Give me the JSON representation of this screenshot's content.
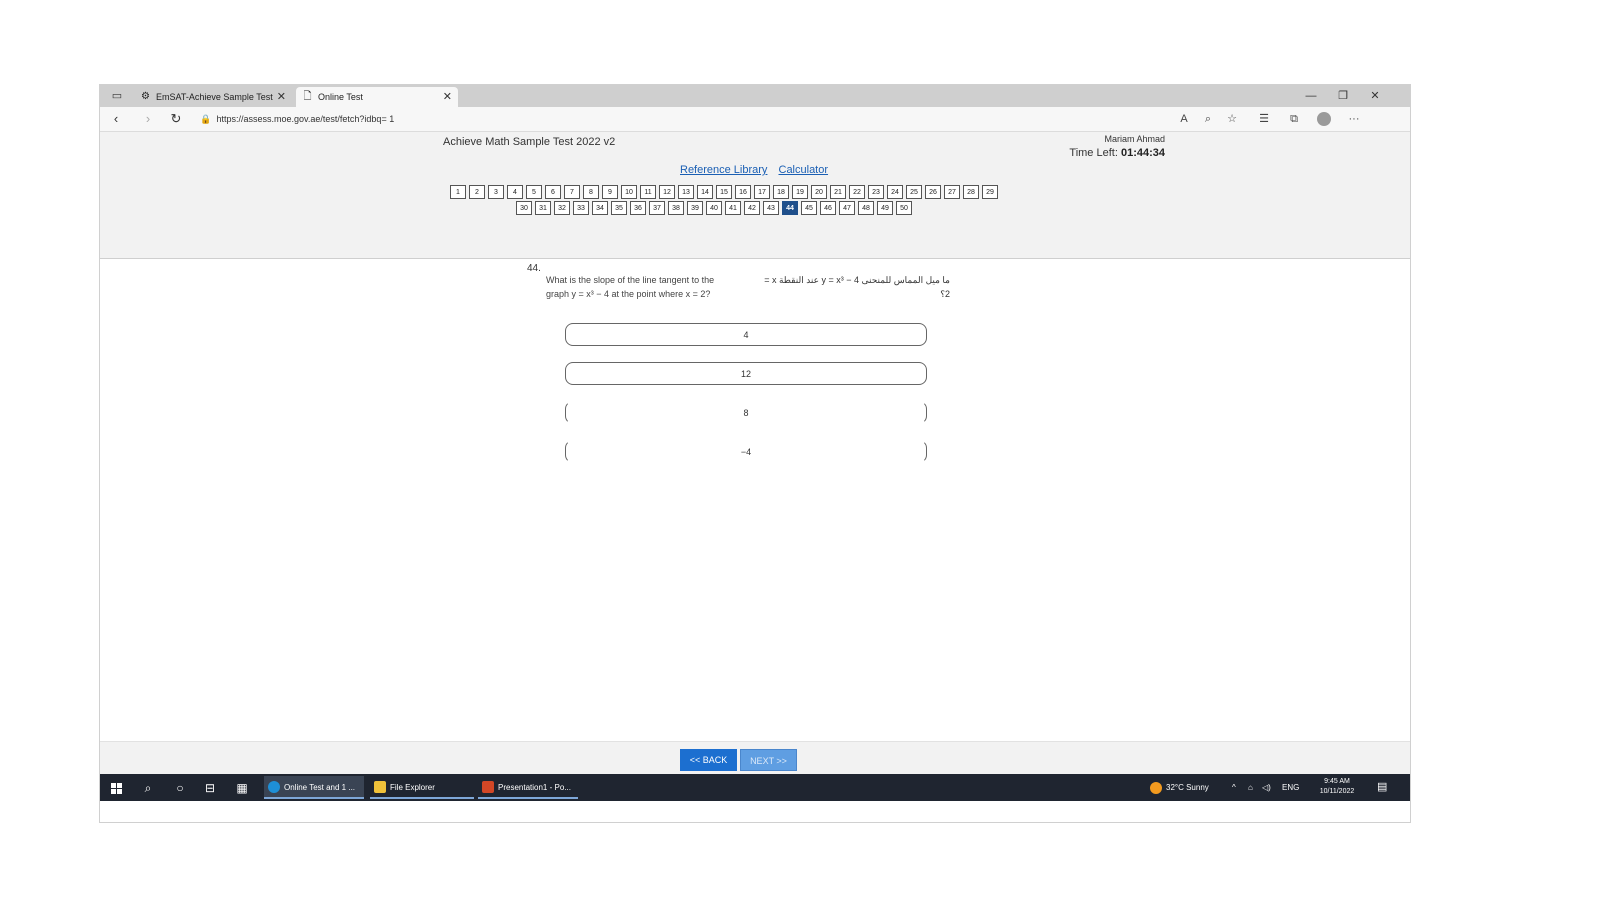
{
  "browser": {
    "tabs": [
      {
        "label": "EmSAT-Achieve Sample Test",
        "icon": "emsat-favicon"
      },
      {
        "label": "Online Test",
        "icon": "page-icon"
      }
    ],
    "url": "https://assess.moe.gov.ae/test/fetch?idbq= 1"
  },
  "test": {
    "title": "Achieve Math Sample Test 2022 v2",
    "student_name": "Mariam Ahmad",
    "time_left_label": "Time Left:",
    "time_left_value": "01:44:34",
    "links": {
      "reference": "Reference Library",
      "calculator": "Calculator"
    },
    "questions_row1": [
      "1",
      "2",
      "3",
      "4",
      "5",
      "6",
      "7",
      "8",
      "9",
      "10",
      "11",
      "12",
      "13",
      "14",
      "15",
      "16",
      "17",
      "18",
      "19",
      "20",
      "21",
      "22",
      "23",
      "24",
      "25",
      "26",
      "27",
      "28",
      "29"
    ],
    "questions_row2": [
      "30",
      "31",
      "32",
      "33",
      "34",
      "35",
      "36",
      "37",
      "38",
      "39",
      "40",
      "41",
      "42",
      "43",
      "44",
      "45",
      "46",
      "47",
      "48",
      "49",
      "50"
    ],
    "current_question": "44"
  },
  "question": {
    "number": "44.",
    "text_en_1": "What is the slope of the line tangent to the",
    "text_en_2": "graph y = x³ − 4 at the point where x = 2?",
    "text_ar_1": "ما ميل المماس للمنحنى y = x³ − 4 عند النقطة x =",
    "text_ar_2": "2؟",
    "choices": [
      "4",
      "12",
      "8",
      "−4"
    ]
  },
  "navigation": {
    "back": "<< BACK",
    "next": "NEXT >>"
  },
  "taskbar": {
    "apps": [
      {
        "label": "Online Test and 1 ...",
        "color": "#1e8fd6"
      },
      {
        "label": "File Explorer",
        "color": "#f0c23a"
      },
      {
        "label": "Presentation1 - Po...",
        "color": "#d24726"
      }
    ],
    "weather": "32°C  Sunny",
    "language": "ENG",
    "time": "9:45 AM",
    "date": "10/11/2022"
  }
}
